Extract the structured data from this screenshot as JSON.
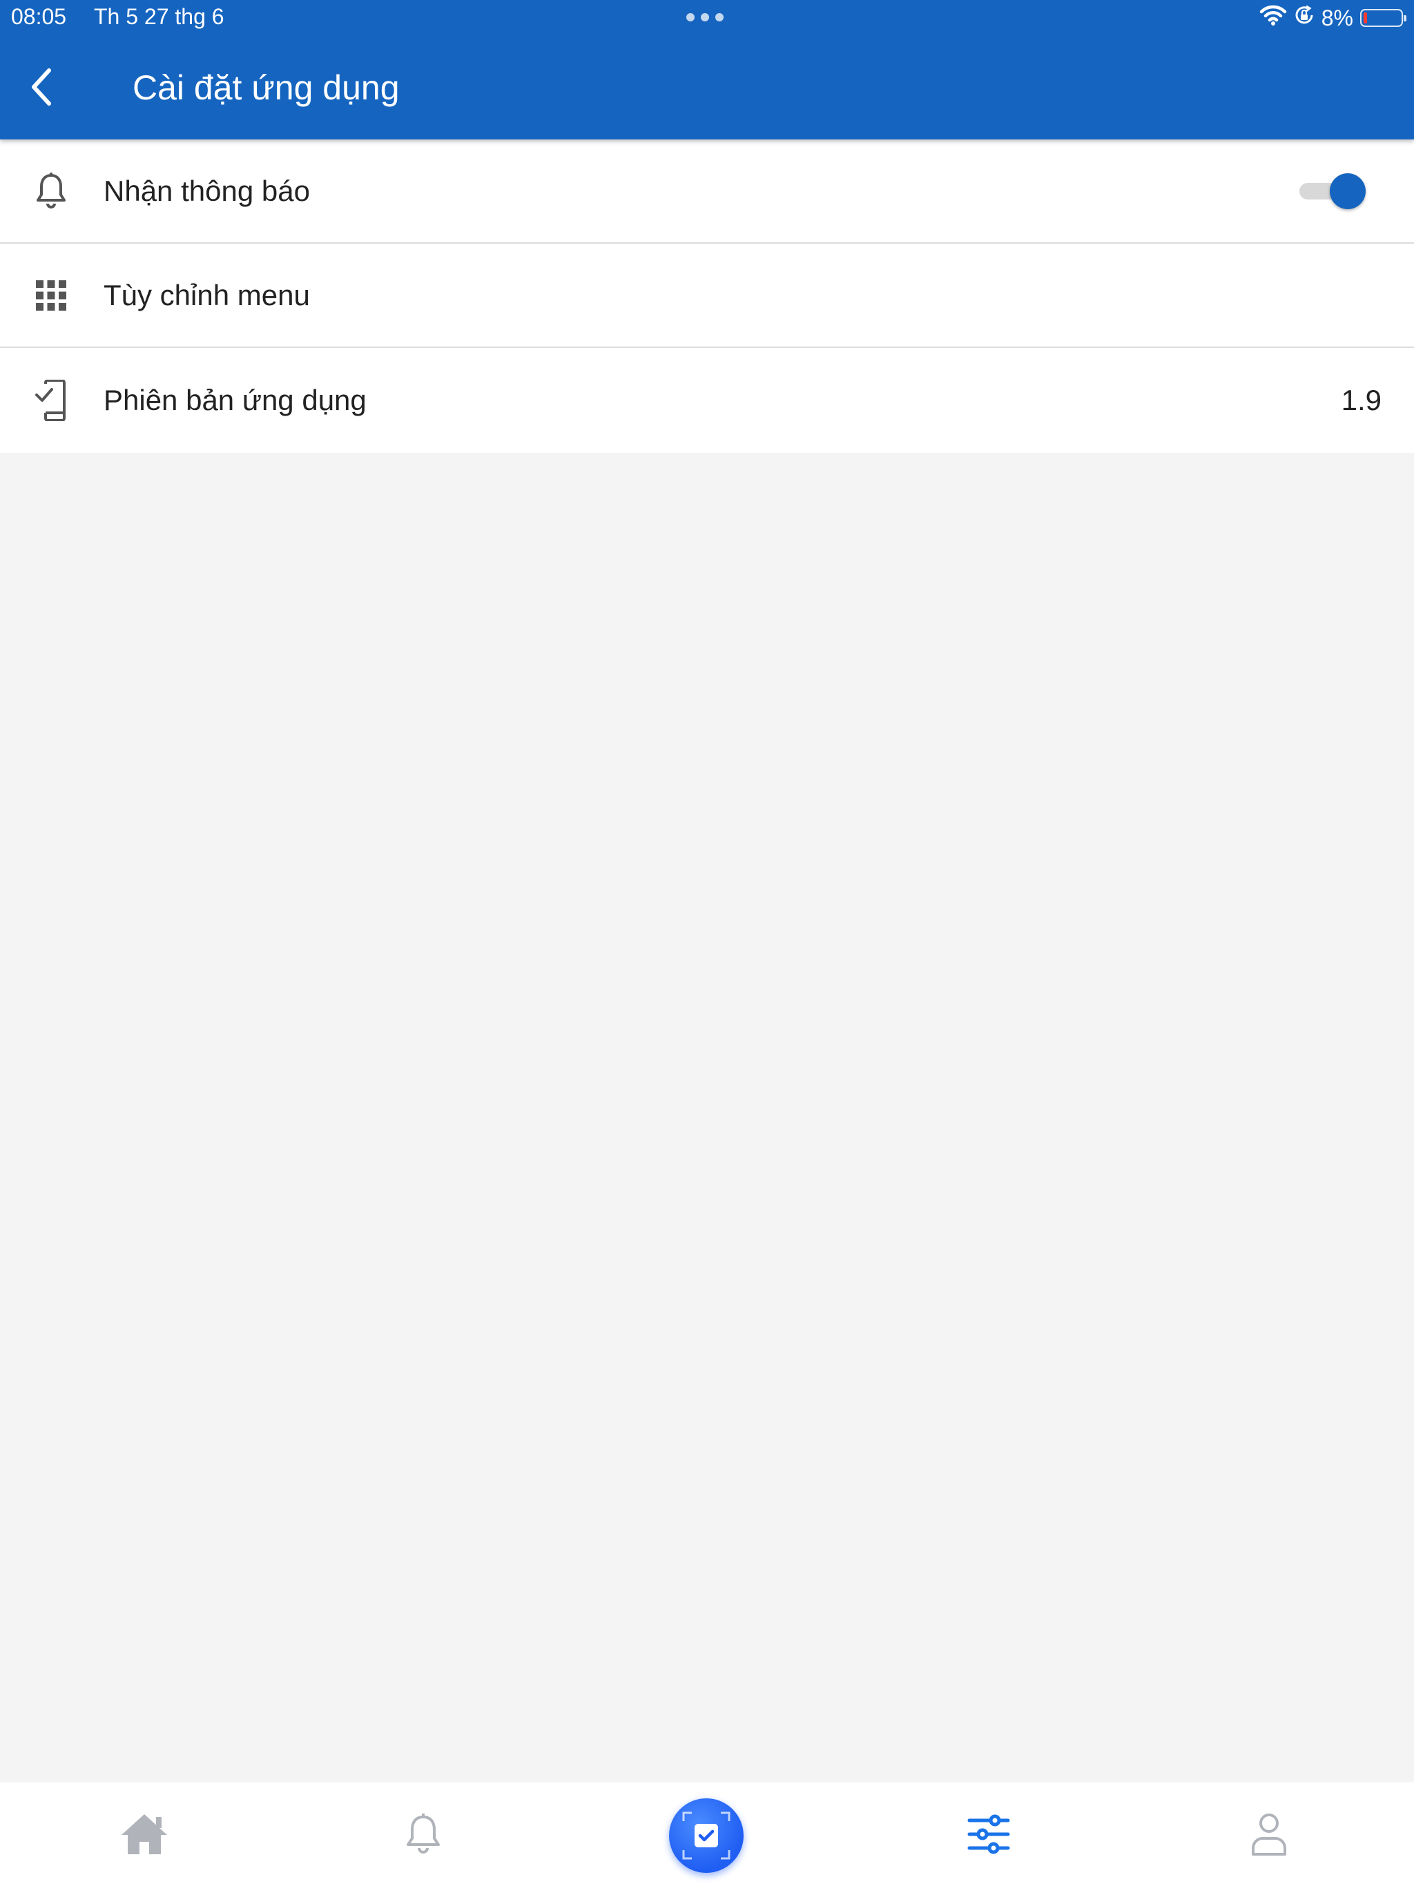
{
  "status_bar": {
    "time": "08:05",
    "date": "Th 5 27 thg 6",
    "battery": "8%",
    "battery_level": 0.08,
    "icons": [
      "wifi-icon",
      "orientation-lock-icon",
      "battery-icon"
    ]
  },
  "app_bar": {
    "title": "Cài đặt ứng dụng",
    "back_icon": "chevron-left-icon",
    "background": "#1565c0"
  },
  "settings": {
    "items": [
      {
        "icon": "bell-icon",
        "label": "Nhận thông báo",
        "control": "toggle",
        "enabled": true
      },
      {
        "icon": "grid-icon",
        "label": "Tùy chỉnh menu"
      },
      {
        "icon": "phone-check-icon",
        "label": "Phiên bản ứng dụng",
        "value": "1.9"
      }
    ]
  },
  "bottom_nav": {
    "items": [
      {
        "icon": "home-icon",
        "active": false
      },
      {
        "icon": "bell-icon",
        "active": false
      },
      {
        "icon": "scan-check-icon",
        "active": false,
        "style": "fab"
      },
      {
        "icon": "sliders-icon",
        "active": true
      },
      {
        "icon": "user-icon",
        "active": false
      }
    ],
    "active_color": "#1a73e8",
    "inactive_color": "#b0b4ba"
  }
}
